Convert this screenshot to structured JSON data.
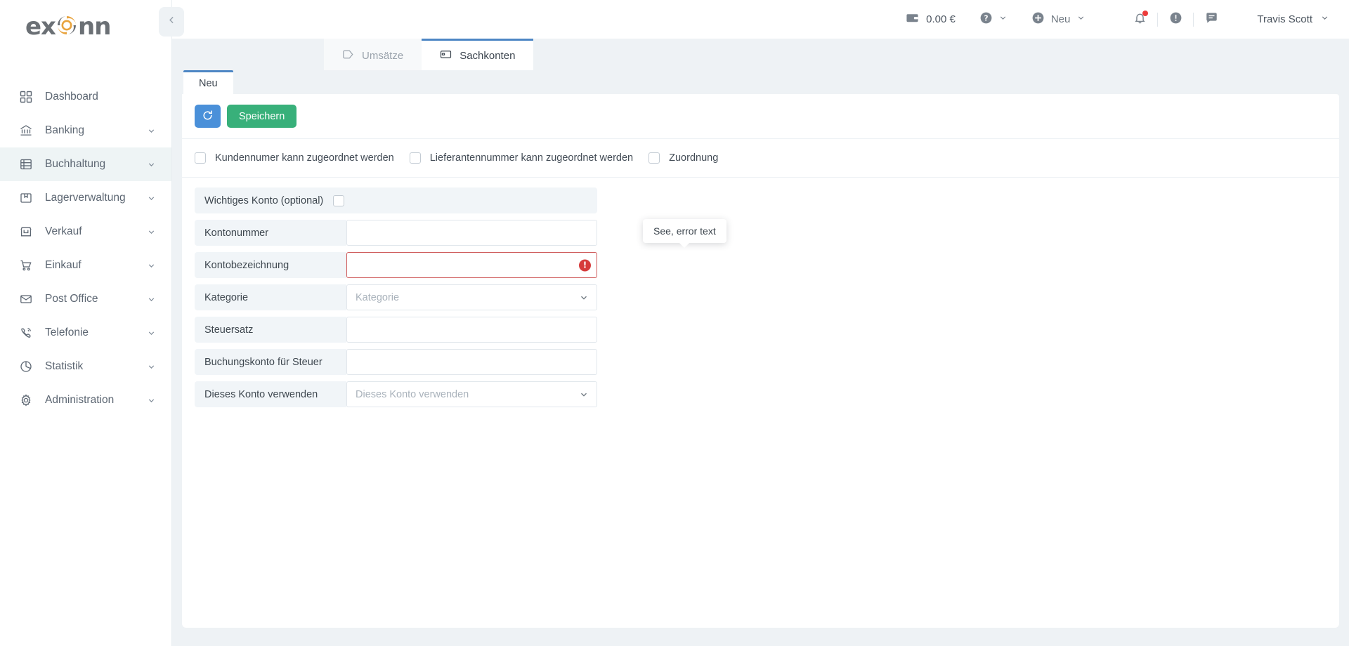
{
  "brand": {
    "logo_text_left": "ex",
    "logo_text_right": "nn",
    "accent_color": "#e8a33d",
    "logo_gray": "#6b7075"
  },
  "sidebar": {
    "collapse_icon": "chevron-left-icon",
    "items": [
      {
        "label": "Dashboard",
        "icon": "grid-icon",
        "expandable": false,
        "active": false
      },
      {
        "label": "Banking",
        "icon": "bank-icon",
        "expandable": true,
        "active": false
      },
      {
        "label": "Buchhaltung",
        "icon": "ledger-icon",
        "expandable": true,
        "active": true
      },
      {
        "label": "Lagerverwaltung",
        "icon": "box-icon",
        "expandable": true,
        "active": false
      },
      {
        "label": "Verkauf",
        "icon": "store-icon",
        "expandable": true,
        "active": false
      },
      {
        "label": "Einkauf",
        "icon": "cart-icon",
        "expandable": true,
        "active": false
      },
      {
        "label": "Post Office",
        "icon": "envelope-icon",
        "expandable": true,
        "active": false
      },
      {
        "label": "Telefonie",
        "icon": "phone-icon",
        "expandable": true,
        "active": false
      },
      {
        "label": "Statistik",
        "icon": "pie-chart-icon",
        "expandable": true,
        "active": false
      },
      {
        "label": "Administration",
        "icon": "gear-icon",
        "expandable": true,
        "active": false
      }
    ]
  },
  "topbar": {
    "wallet_icon": "wallet-icon",
    "balance": "0.00 €",
    "help_icon": "question-circle-icon",
    "new_icon": "plus-circle-icon",
    "new_label": "Neu",
    "notifications_icon": "bell-icon",
    "notifications_has_badge": true,
    "badge_color": "#ec3b3b",
    "alerts_icon": "exclamation-circle-icon",
    "messages_icon": "message-icon",
    "user_name": "Travis Scott",
    "user_chevron_icon": "chevron-down-icon"
  },
  "main_tabs": [
    {
      "label": "Umsätze",
      "icon": "tag-icon",
      "active": false
    },
    {
      "label": "Sachkonten",
      "icon": "card-icon",
      "active": true
    }
  ],
  "sub_tabs": [
    {
      "label": "Neu",
      "active": true
    }
  ],
  "toolbar": {
    "refresh_icon": "refresh-icon",
    "refresh_color": "#4a90d9",
    "save_label": "Speichern",
    "save_color": "#38b07a"
  },
  "checkboxes": [
    {
      "label": "Kundennumer kann zugeordnet werden",
      "checked": false
    },
    {
      "label": "Lieferantennummer kann zugeordnet werden",
      "checked": false
    },
    {
      "label": "Zuordnung",
      "checked": false
    }
  ],
  "form": {
    "important_account": {
      "label": "Wichtiges Konto (optional)",
      "checked": false
    },
    "fields": [
      {
        "label": "Kontonummer",
        "type": "text",
        "value": "",
        "placeholder": "",
        "error": false
      },
      {
        "label": "Kontobezeichnung",
        "type": "text",
        "value": "",
        "placeholder": "",
        "error": true
      },
      {
        "label": "Kategorie",
        "type": "select",
        "value": "",
        "placeholder": "Kategorie",
        "error": false
      },
      {
        "label": "Steuersatz",
        "type": "text",
        "value": "",
        "placeholder": "",
        "error": false
      },
      {
        "label": "Buchungskonto für Steuer",
        "type": "text",
        "value": "",
        "placeholder": "",
        "error": false
      },
      {
        "label": "Dieses Konto verwenden",
        "type": "select",
        "value": "",
        "placeholder": "Dieses Konto verwenden",
        "error": false
      }
    ]
  },
  "tooltip": {
    "text": "See, error text"
  },
  "error": {
    "icon": "exclamation-circle-filled-icon",
    "color": "#d63b3b"
  }
}
